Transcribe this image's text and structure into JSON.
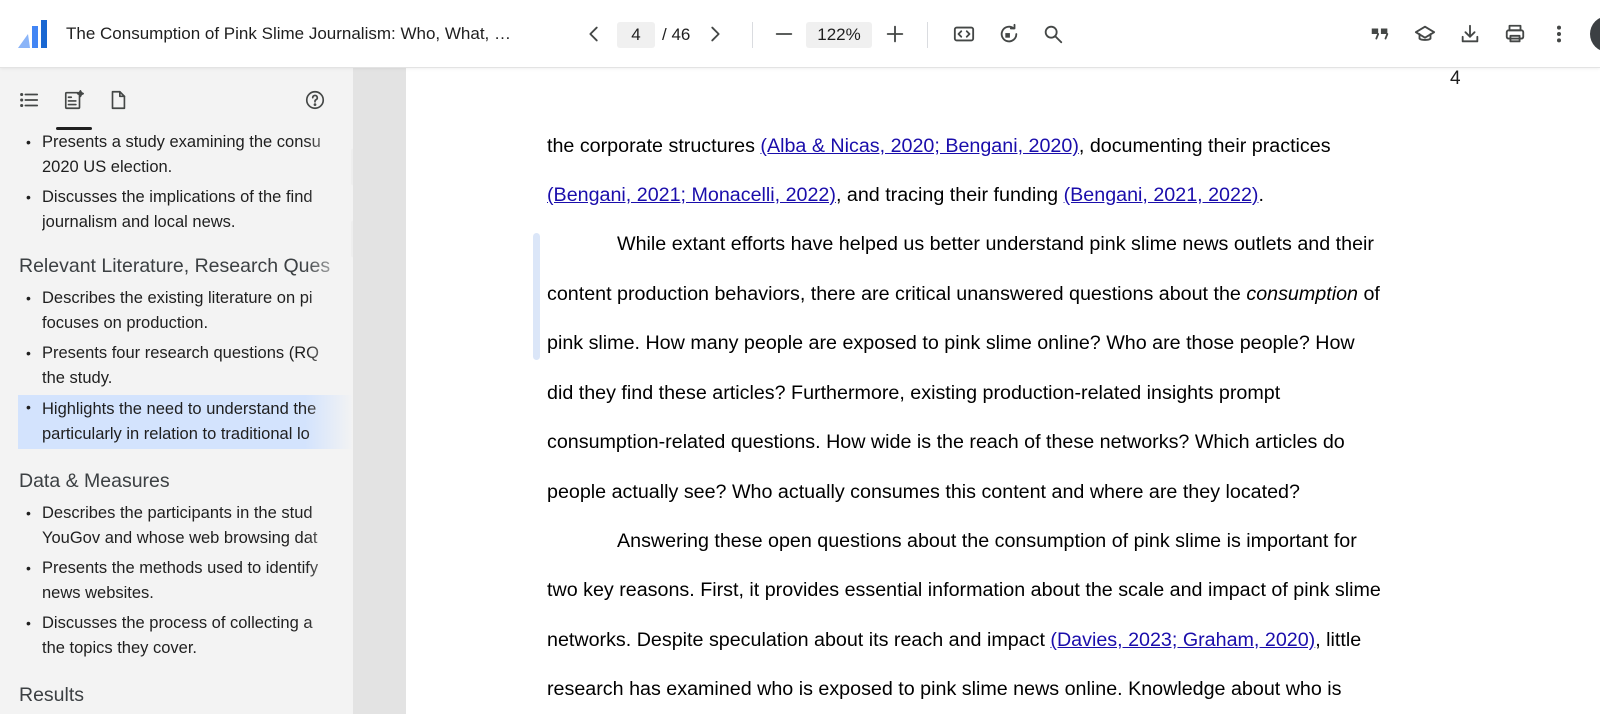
{
  "toolbar": {
    "title": "The Consumption of Pink Slime Journalism: Who, What, …",
    "current_page": "4",
    "total_pages": "/ 46",
    "zoom": "122%"
  },
  "sidebar": {
    "sections": [
      {
        "heading": "",
        "bullets": [
          {
            "l1": "Presents a study examining the consu",
            "l2": "2020 US election."
          },
          {
            "l1": "Discusses the implications of the find",
            "l2": "journalism and local news."
          }
        ]
      },
      {
        "heading": "Relevant Literature, Research Ques",
        "bullets": [
          {
            "l1": "Describes the existing literature on pi",
            "l2": "focuses on production."
          },
          {
            "l1": "Presents four research questions (RQ",
            "l2": "the study."
          },
          {
            "l1": "Highlights the need to understand the",
            "l2": "particularly in relation to traditional lo"
          }
        ]
      },
      {
        "heading": "Data & Measures",
        "bullets": [
          {
            "l1": "Describes the participants in the stud",
            "l2": "YouGov and whose web browsing dat"
          },
          {
            "l1": "Presents the methods used to identify",
            "l2": "news websites."
          },
          {
            "l1": "Discusses the process of collecting a",
            "l2": "the topics they cover."
          }
        ]
      },
      {
        "heading": "Results",
        "bullets": []
      }
    ]
  },
  "document": {
    "page_number": "4",
    "l1": {
      "a": "the corporate structures ",
      "c1": "(Alba & Nicas, 2020; Bengani, 2020)",
      "b": ", documenting their practices"
    },
    "l2": {
      "c1": "(Bengani, 2021; Monacelli, 2022)",
      "a": ", and tracing their funding ",
      "c2": "(Bengani, 2021, 2022)",
      "b": "."
    },
    "l3": "While extant efforts have helped us better understand pink slime news outlets and their",
    "l4": {
      "a": "content production behaviors, there are critical unanswered questions about the ",
      "em": "consumption",
      "b": " of"
    },
    "l5": "pink slime. How many people are exposed to pink slime online? Who are those people? How",
    "l6": "did they find these articles? Furthermore, existing production-related insights prompt",
    "l7": "consumption-related questions. How wide is the reach of these networks? Which articles do",
    "l8": "people actually see? Who actually consumes this content and where are they located?",
    "l9": "Answering these open questions about the consumption of pink slime is important for",
    "l10": "two key reasons. First, it provides essential information about the scale and impact of pink slime",
    "l11": {
      "a": "networks. Despite speculation about its reach and impact ",
      "c1": "(Davies, 2023; Graham, 2020)",
      "b": ", little"
    },
    "l12": "research has examined who is exposed to pink slime news online. Knowledge about who is"
  },
  "colors": {
    "link": "#1a0dab",
    "active_item": "#d3e3fd",
    "sidebar_bg": "#f3f3f3",
    "viewer_bg": "#e3e3e3"
  },
  "icons": [
    "app-logo-icon",
    "chevron-left-icon",
    "chevron-right-icon",
    "minus-icon",
    "plus-icon",
    "fit-page-icon",
    "rotate-icon",
    "search-icon",
    "quote-icon",
    "cap-icon",
    "download-icon",
    "print-icon",
    "more-icon",
    "outline-icon",
    "summary-icon",
    "page-icon",
    "help-icon"
  ]
}
